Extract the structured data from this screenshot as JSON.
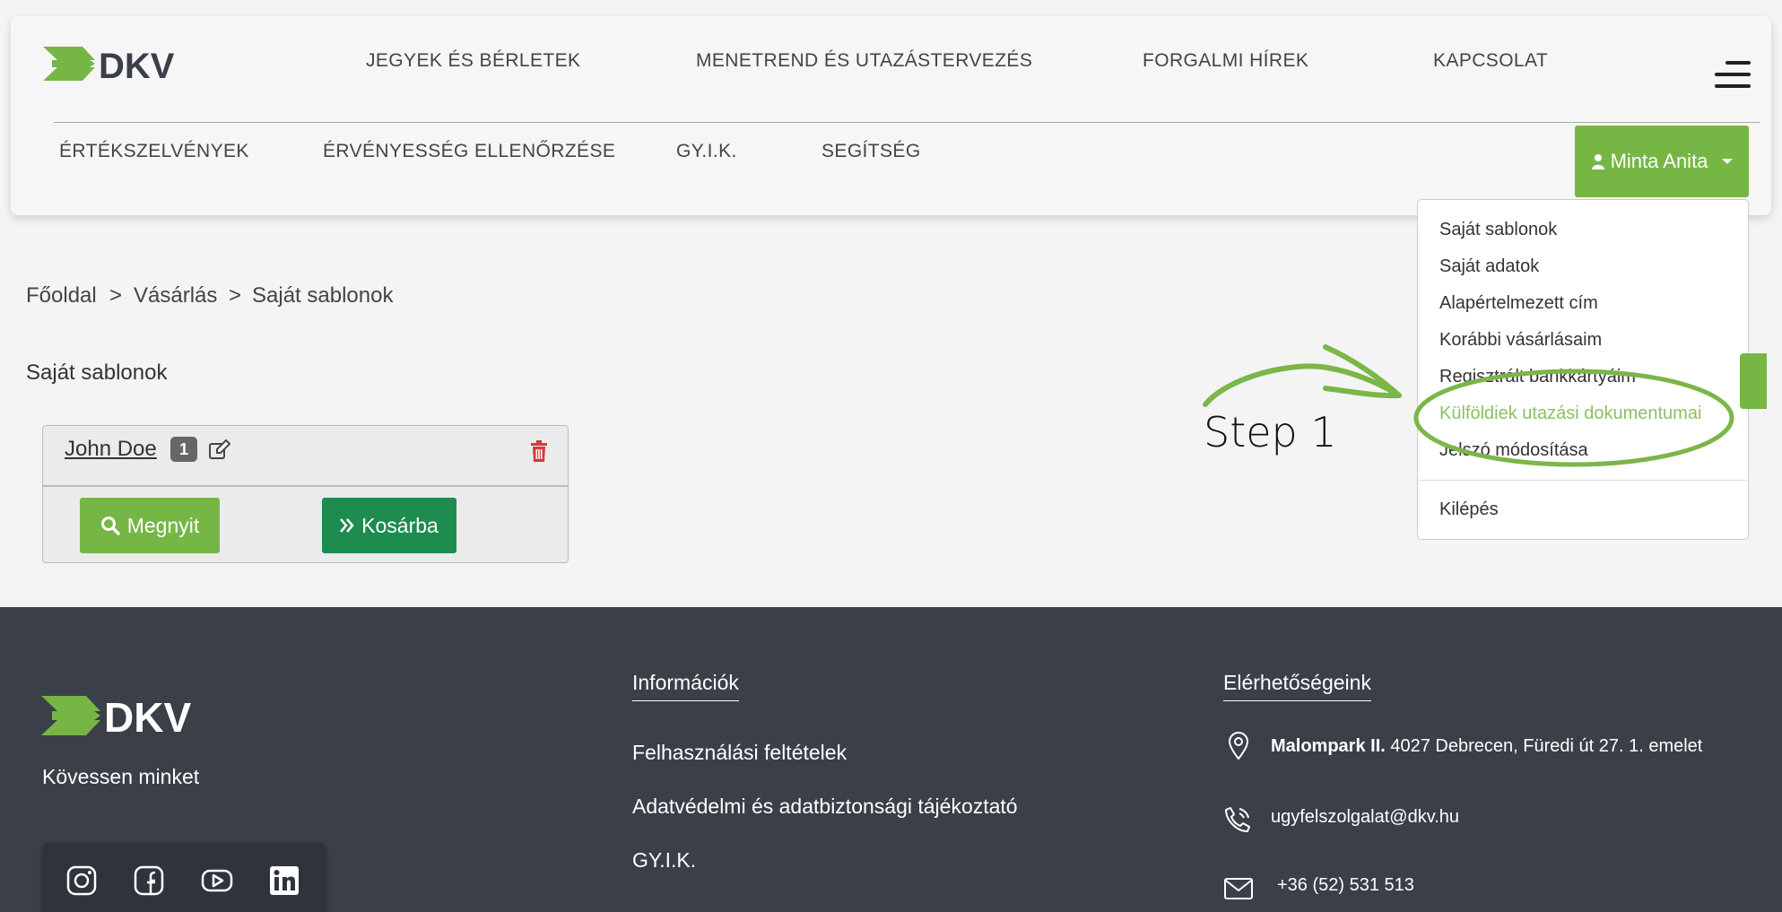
{
  "brand": {
    "logo_text": "DKV",
    "green": "#76b645",
    "dark_green": "#1e8c4f"
  },
  "nav": {
    "top": [
      "JEGYEK ÉS BÉRLETEK",
      "MENETREND ÉS UTAZÁSTERVEZÉS",
      "FORGALMI HÍREK",
      "KAPCSOLAT"
    ],
    "bottom": [
      "ÉRTÉKSZELVÉNYEK",
      "ÉRVÉNYESSÉG ELLENŐRZÉSE",
      "GY.I.K.",
      "SEGÍTSÉG"
    ]
  },
  "user_menu": {
    "button_label": "Minta Anita",
    "items": [
      "Saját sablonok",
      "Saját adatok",
      "Alapértelmezett cím",
      "Korábbi vásárlásaim",
      "Regisztrált bankkártyáim",
      "Külföldiek utazási dokumentumai",
      "Jelszó módosítása"
    ],
    "logout": "Kilépés",
    "highlighted_item": "Külföldiek utazási dokumentumai"
  },
  "breadcrumb": {
    "items": [
      "Főoldal",
      "Vásárlás",
      "Saját sablonok"
    ],
    "separator": ">"
  },
  "page_title": "Saját sablonok",
  "template_card": {
    "name": "John Doe",
    "count": "1",
    "open_label": "Megnyit",
    "cart_label": "Kosárba"
  },
  "annotation": {
    "label": "Step 1",
    "color": "#7ab648"
  },
  "footer": {
    "tagline": "Kövessen minket",
    "info_heading": "Információk",
    "info_links": [
      "Felhasználási feltételek",
      "Adatvédelmi és adatbiztonsági tájékoztató",
      "GY.I.K."
    ],
    "contact_heading": "Elérhetőségeink",
    "address_bold": "Malompark II.",
    "address_rest": " 4027 Debrecen, Füredi út 27. 1. emelet",
    "email": "ugyfelszolgalat@dkv.hu",
    "phone": "+36 (52) 531 513",
    "social": [
      "instagram-icon",
      "facebook-icon",
      "youtube-icon",
      "linkedin-icon"
    ]
  }
}
